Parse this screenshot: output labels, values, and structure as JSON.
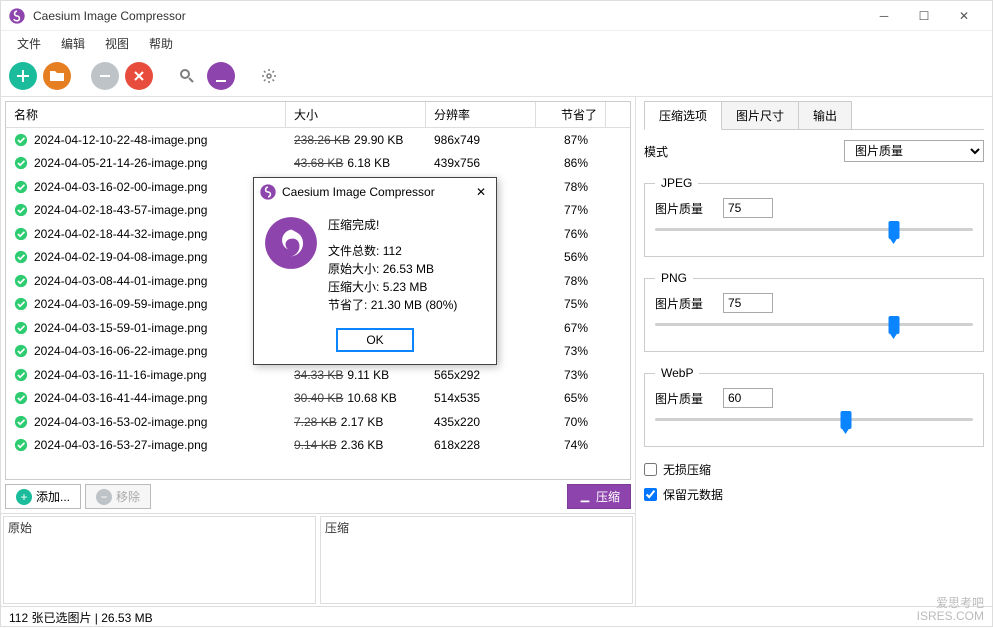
{
  "app": {
    "title": "Caesium Image Compressor"
  },
  "menu": {
    "file": "文件",
    "edit": "编辑",
    "view": "视图",
    "help": "帮助"
  },
  "table": {
    "headers": {
      "name": "名称",
      "size": "大小",
      "resolution": "分辨率",
      "saved": "节省了"
    },
    "rows": [
      {
        "name": "2024-04-12-10-22-48-image.png",
        "orig": "238.26 KB",
        "new": "29.90 KB",
        "res": "986x749",
        "saved": "87%"
      },
      {
        "name": "2024-04-05-21-14-26-image.png",
        "orig": "43.68 KB",
        "new": "6.18 KB",
        "res": "439x756",
        "saved": "86%"
      },
      {
        "name": "2024-04-03-16-02-00-image.png",
        "orig": "",
        "new": "",
        "res": "",
        "saved": "78%"
      },
      {
        "name": "2024-04-02-18-43-57-image.png",
        "orig": "",
        "new": "",
        "res": "",
        "saved": "77%"
      },
      {
        "name": "2024-04-02-18-44-32-image.png",
        "orig": "",
        "new": "",
        "res": "",
        "saved": "76%"
      },
      {
        "name": "2024-04-02-19-04-08-image.png",
        "orig": "",
        "new": "",
        "res": "",
        "saved": "56%"
      },
      {
        "name": "2024-04-03-08-44-01-image.png",
        "orig": "",
        "new": "",
        "res": "",
        "saved": "78%"
      },
      {
        "name": "2024-04-03-16-09-59-image.png",
        "orig": "",
        "new": "",
        "res": "",
        "saved": "75%"
      },
      {
        "name": "2024-04-03-15-59-01-image.png",
        "orig": "",
        "new": "",
        "res": "",
        "saved": "67%"
      },
      {
        "name": "2024-04-03-16-06-22-image.png",
        "orig": "",
        "new": "",
        "res": "",
        "saved": "73%"
      },
      {
        "name": "2024-04-03-16-11-16-image.png",
        "orig": "34.33 KB",
        "new": "9.11 KB",
        "res": "565x292",
        "saved": "73%"
      },
      {
        "name": "2024-04-03-16-41-44-image.png",
        "orig": "30.40 KB",
        "new": "10.68 KB",
        "res": "514x535",
        "saved": "65%"
      },
      {
        "name": "2024-04-03-16-53-02-image.png",
        "orig": "7.28 KB",
        "new": "2.17 KB",
        "res": "435x220",
        "saved": "70%"
      },
      {
        "name": "2024-04-03-16-53-27-image.png",
        "orig": "9.14 KB",
        "new": "2.36 KB",
        "res": "618x228",
        "saved": "74%"
      }
    ]
  },
  "actions": {
    "add": "添加...",
    "remove": "移除",
    "compress": "压缩"
  },
  "preview": {
    "original": "原始",
    "compressed": "压缩"
  },
  "status": {
    "text": "112 张已选图片 | 26.53 MB"
  },
  "watermark": {
    "line1": "爱思考吧",
    "line2": "ISRES.COM"
  },
  "sidebar": {
    "tabs": {
      "compress": "压缩选项",
      "size": "图片尺寸",
      "output": "输出"
    },
    "mode_label": "模式",
    "mode_value": "图片质量",
    "jpeg": {
      "title": "JPEG",
      "quality_label": "图片质量",
      "quality": "75"
    },
    "png": {
      "title": "PNG",
      "quality_label": "图片质量",
      "quality": "75"
    },
    "webp": {
      "title": "WebP",
      "quality_label": "图片质量",
      "quality": "60"
    },
    "lossless": "无损压缩",
    "keep_meta": "保留元数据"
  },
  "dialog": {
    "title": "Caesium Image Compressor",
    "heading": "压缩完成!",
    "total_label": "文件总数:",
    "total": "112",
    "orig_label": "原始大小:",
    "orig": "26.53 MB",
    "comp_label": "压缩大小:",
    "comp": "5.23 MB",
    "saved_label": "节省了:",
    "saved": "21.30 MB (80%)",
    "ok": "OK"
  }
}
